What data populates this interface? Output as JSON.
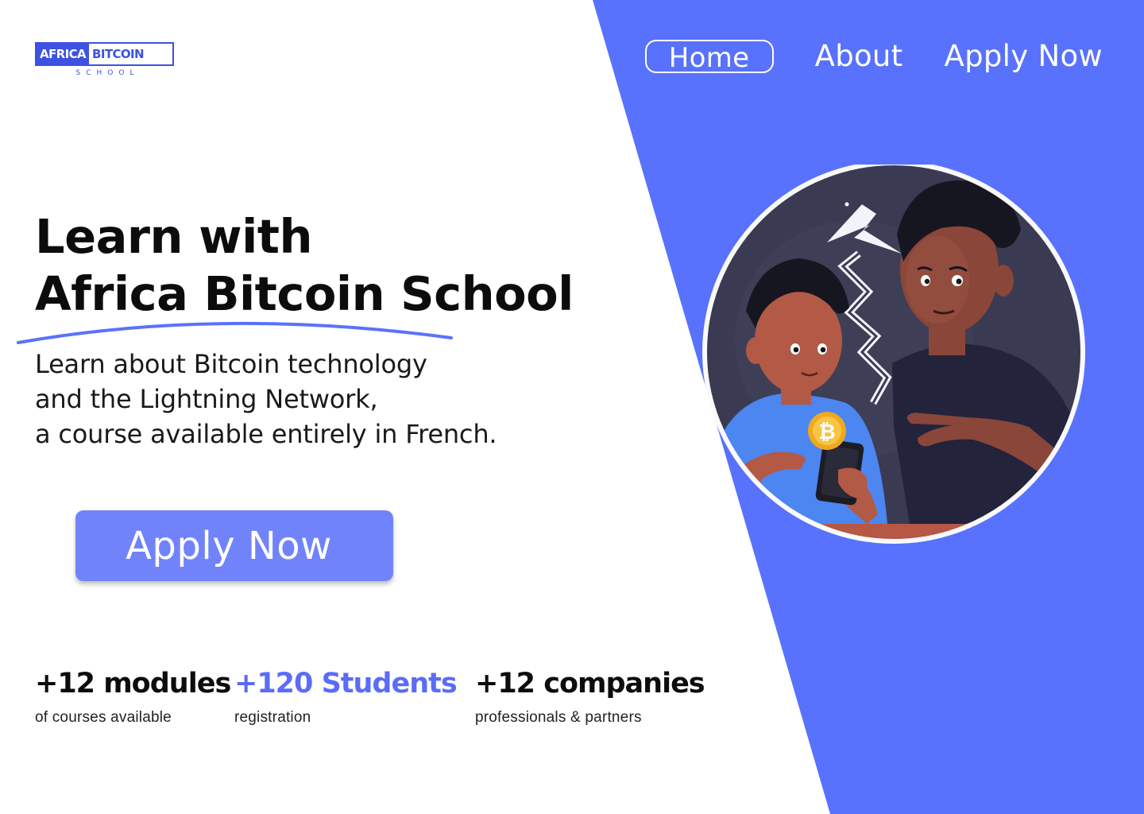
{
  "brand": {
    "logo_left": "AFRICA",
    "logo_right": "BITCOIN",
    "logo_sub": "SCHOOL",
    "accent_color": "#5b72fc",
    "logo_color": "#3d52e0"
  },
  "nav": {
    "items": [
      "Home",
      "About",
      "Apply Now"
    ],
    "active": "Home"
  },
  "hero": {
    "headline_line1": "Learn with",
    "headline_line2": "Africa Bitcoin School",
    "subtitle_lines": [
      "Learn about Bitcoin technology",
      "and the Lightning Network,",
      "a course available entirely in French."
    ],
    "cta_label": "Apply Now",
    "cta_color": "#7183fb"
  },
  "stats": [
    {
      "value": "+12 modules",
      "label": "of courses available"
    },
    {
      "value": "+120 Students",
      "label": "registration"
    },
    {
      "value": "+12 companies",
      "label": "professionals & partners"
    }
  ],
  "illustration": {
    "icon": "bitcoin-coin-icon",
    "coin_symbol": "₿"
  }
}
